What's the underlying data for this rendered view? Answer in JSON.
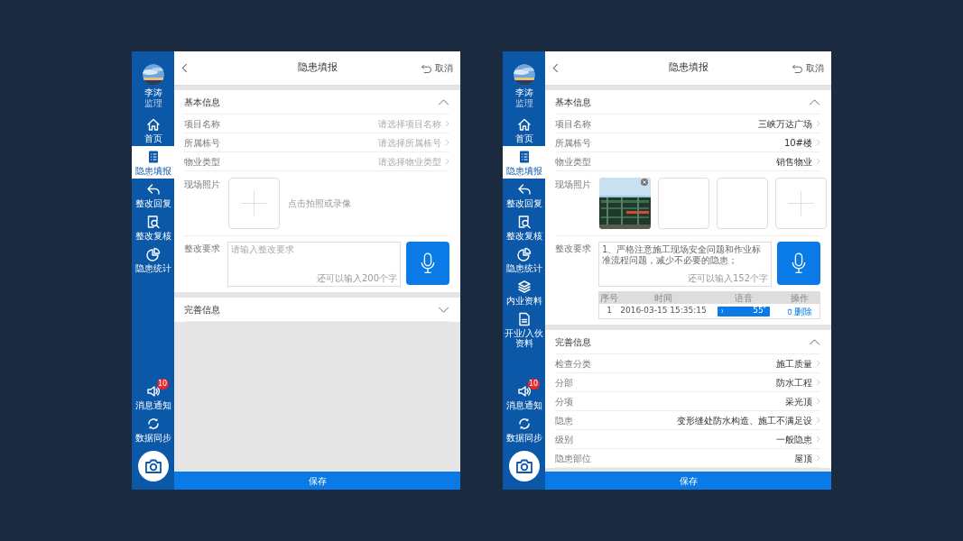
{
  "screens": [
    {
      "user": {
        "name": "李涛",
        "role": "监理"
      },
      "nav": [
        {
          "label": "首页",
          "selected": false
        },
        {
          "label": "隐患填报",
          "selected": true
        },
        {
          "label": "整改回复",
          "selected": false
        },
        {
          "label": "整改复核",
          "selected": false
        },
        {
          "label": "隐患统计",
          "selected": false
        }
      ],
      "bottom_nav": [
        {
          "label": "消息通知",
          "badge": "10"
        },
        {
          "label": "数据同步"
        }
      ],
      "header": {
        "title": "隐患填报",
        "cancel": "取消"
      },
      "sections": [
        {
          "title": "基本信息",
          "expanded": true,
          "fields": [
            {
              "kind": "select",
              "label": "项目名称",
              "placeholder": "请选择项目名称"
            },
            {
              "kind": "select",
              "label": "所属栋号",
              "placeholder": "请选择所属栋号"
            },
            {
              "kind": "select",
              "label": "物业类型",
              "placeholder": "请选择物业类型"
            },
            {
              "kind": "photos",
              "label": "现场照片",
              "slots": [
                {
                  "kind": "add"
                }
              ],
              "hint": "点击拍照或录像"
            },
            {
              "kind": "text",
              "label": "整改要求",
              "placeholder": "请输入整改要求",
              "counter": "还可以输入200个字"
            }
          ]
        },
        {
          "title": "完善信息",
          "expanded": false
        }
      ],
      "save": "保存"
    },
    {
      "user": {
        "name": "李涛",
        "role": "监理"
      },
      "nav": [
        {
          "label": "首页",
          "selected": false
        },
        {
          "label": "隐患填报",
          "selected": true
        },
        {
          "label": "整改回复",
          "selected": false
        },
        {
          "label": "整改复核",
          "selected": false
        },
        {
          "label": "隐患统计",
          "selected": false
        },
        {
          "label": "内业资料",
          "selected": false
        },
        {
          "label": "开业/入伙资料",
          "selected": false
        }
      ],
      "bottom_nav": [
        {
          "label": "消息通知",
          "badge": "10"
        },
        {
          "label": "数据同步"
        }
      ],
      "header": {
        "title": "隐患填报",
        "cancel": "取消"
      },
      "sections": [
        {
          "title": "基本信息",
          "expanded": true,
          "fields": [
            {
              "kind": "select",
              "label": "项目名称",
              "value": "三峡万达广场"
            },
            {
              "kind": "select",
              "label": "所属栋号",
              "value": "10#楼"
            },
            {
              "kind": "select",
              "label": "物业类型",
              "value": "销售物业"
            },
            {
              "kind": "photos",
              "label": "现场照片",
              "slots": [
                {
                  "kind": "picture"
                },
                {
                  "kind": "empty"
                },
                {
                  "kind": "empty"
                },
                {
                  "kind": "add"
                }
              ]
            },
            {
              "kind": "text",
              "label": "整改要求",
              "value": "1、严格注意施工现场安全问题和作业标准流程问题，减少不必要的隐患；",
              "counter": "还可以输入152个字",
              "recordings": {
                "columns": [
                  "序号",
                  "时间",
                  "语音",
                  "操作"
                ],
                "rows": [
                  {
                    "index": "1",
                    "time": "2016-03-15  15:35:15",
                    "duration": "55″",
                    "action": "删除"
                  }
                ]
              }
            }
          ]
        },
        {
          "title": "完善信息",
          "expanded": true,
          "fields": [
            {
              "kind": "select",
              "label": "检查分类",
              "value": "施工质量"
            },
            {
              "kind": "select",
              "label": "分部",
              "value": "防水工程"
            },
            {
              "kind": "select",
              "label": "分项",
              "value": "采光顶"
            },
            {
              "kind": "select",
              "label": "隐患",
              "value": "变形缝处防水构造、施工不满足设"
            },
            {
              "kind": "select",
              "label": "级别",
              "value": "一般隐患"
            },
            {
              "kind": "select",
              "label": "隐患部位",
              "value": "屋顶"
            }
          ]
        }
      ],
      "save": "保存"
    }
  ]
}
